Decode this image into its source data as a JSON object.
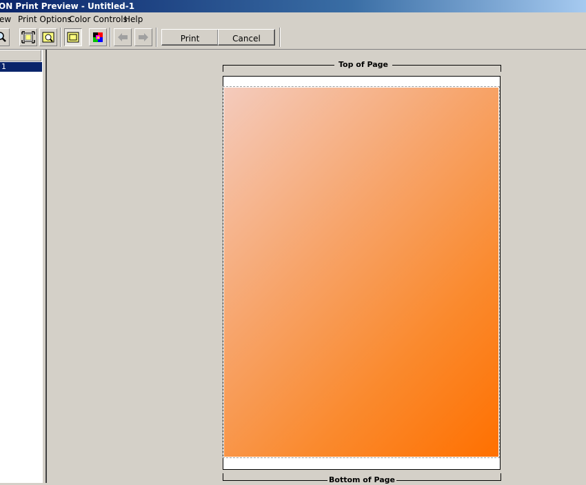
{
  "window": {
    "title": "ON Print Preview - Untitled-1"
  },
  "menu": {
    "items": [
      {
        "label": "ew"
      },
      {
        "label": "Print Options"
      },
      {
        "label": "Color Controls"
      },
      {
        "label": "Help"
      }
    ]
  },
  "toolbar": {
    "icons": [
      "zoom-icon",
      "fit-page-icon",
      "zoom-page-icon",
      "page-outline-icon",
      "color-swatch-icon",
      "arrow-left-icon",
      "arrow-right-icon"
    ],
    "print_label": "Print",
    "cancel_label": "Cancel"
  },
  "pages_list": {
    "items": [
      {
        "label": "1"
      }
    ]
  },
  "preview": {
    "top_label": "Top of Page",
    "bottom_label": "Bottom of Page",
    "image_gradient": {
      "start": "#f4cbbd",
      "end": "#ff7000"
    }
  }
}
